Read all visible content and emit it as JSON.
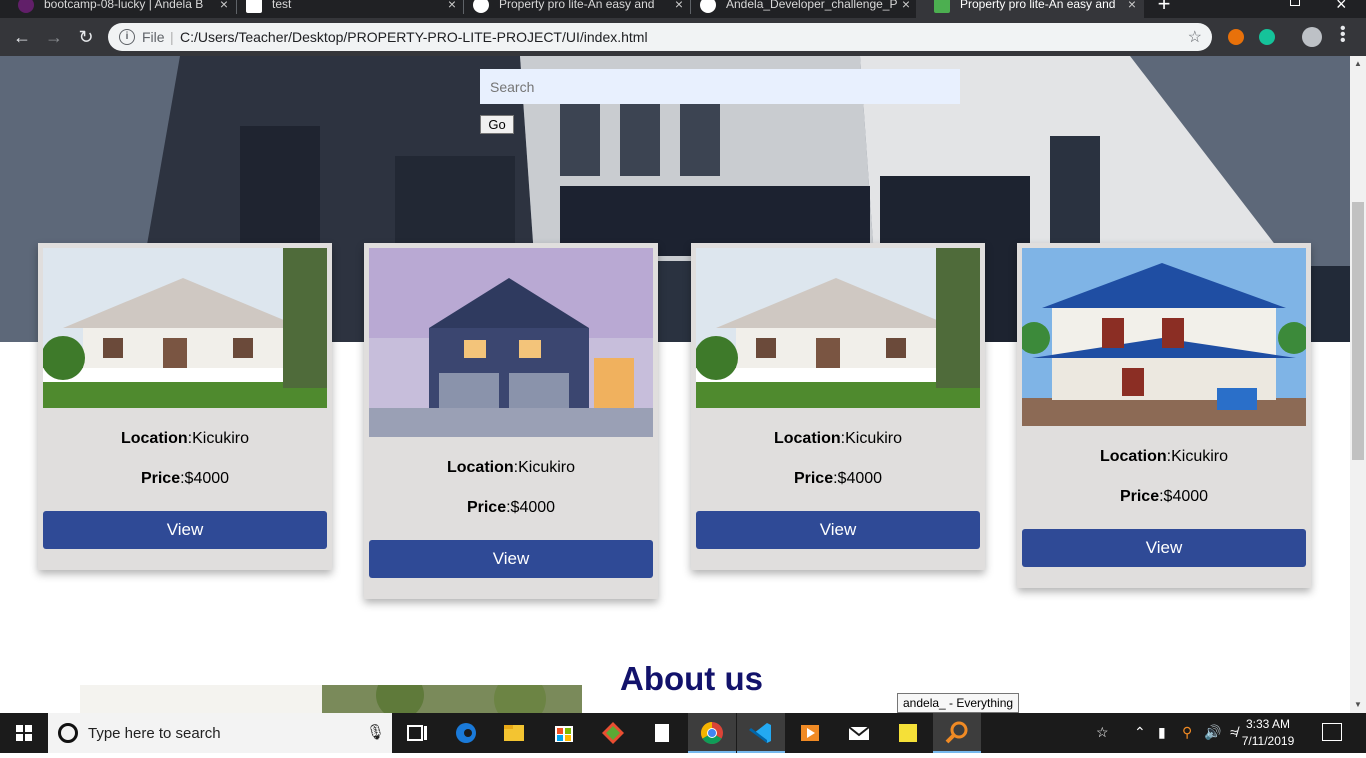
{
  "browser": {
    "tabs": [
      {
        "title": "bootcamp-08-lucky | Andela B",
        "active": false
      },
      {
        "title": "test",
        "active": false
      },
      {
        "title": "Property pro lite-An easy and",
        "active": false
      },
      {
        "title": "Andela_Developer_challenge_P",
        "active": false
      },
      {
        "title": "Property pro lite-An easy and",
        "active": true
      }
    ],
    "close_glyph": "×",
    "new_tab_glyph": "+",
    "omnibox": {
      "info_icon": "i",
      "scheme_label": "File",
      "separator": "|",
      "url": "C:/Users/Teacher/Desktop/PROPERTY-PRO-LITE-PROJECT/UI/index.html"
    }
  },
  "page": {
    "search": {
      "placeholder": "Search",
      "button_label": "Go"
    },
    "properties": [
      {
        "location_label": "Location",
        "location": ":Kicukiro",
        "price_label": "Price",
        "price": ":$4000",
        "button_label": "View",
        "image": "cottage"
      },
      {
        "location_label": "Location",
        "location": ":Kicukiro",
        "price_label": "Price",
        "price": ":$4000",
        "button_label": "View",
        "image": "modern-house"
      },
      {
        "location_label": "Location",
        "location": ":Kicukiro",
        "price_label": "Price",
        "price": ":$4000",
        "button_label": "View",
        "image": "cottage"
      },
      {
        "location_label": "Location",
        "location": ":Kicukiro",
        "price_label": "Price",
        "price": ":$4000",
        "button_label": "View",
        "image": "villa"
      }
    ],
    "about_title": "About us"
  },
  "tooltip": "andela_ - Everything",
  "taskbar": {
    "search_placeholder": "Type here to search",
    "time": "3:33 AM",
    "date": "7/11/2019"
  },
  "colors": {
    "view_button": "#2f4a96",
    "card_bg": "#e0dedd",
    "about_title": "#12126b",
    "search_bg": "#e8f0fe"
  }
}
